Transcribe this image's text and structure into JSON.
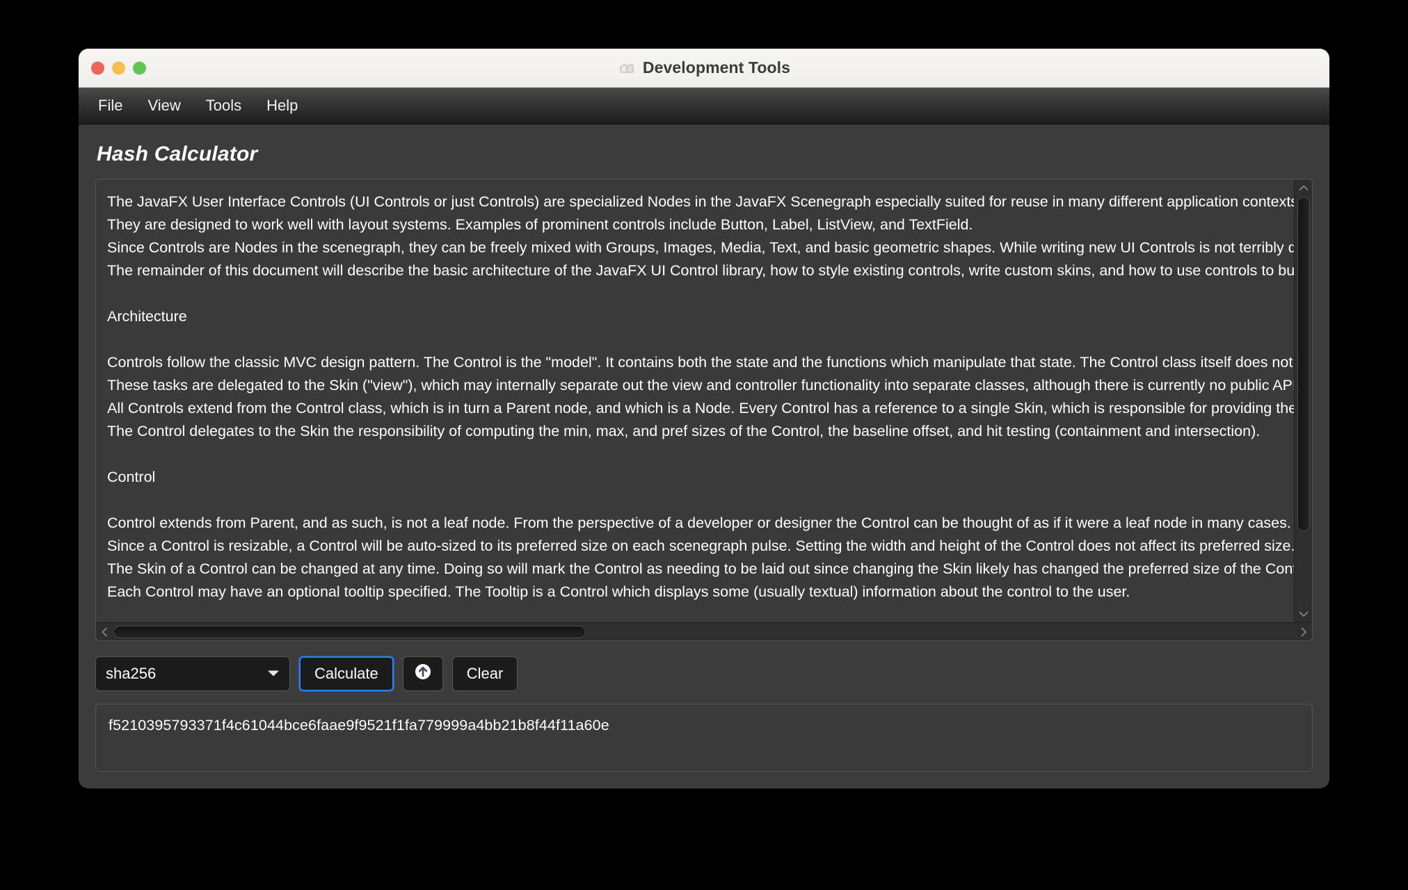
{
  "window": {
    "title": "Development Tools",
    "title_icon": "toolbox-icon",
    "traffic_lights": [
      {
        "name": "close",
        "color": "#f0655b"
      },
      {
        "name": "minimize",
        "color": "#f6bd50"
      },
      {
        "name": "zoom",
        "color": "#62c554"
      }
    ]
  },
  "menubar": {
    "items": [
      {
        "label": "File"
      },
      {
        "label": "View"
      },
      {
        "label": "Tools"
      },
      {
        "label": "Help"
      }
    ]
  },
  "page": {
    "title": "Hash Calculator"
  },
  "textarea": {
    "lines": [
      "The JavaFX User Interface Controls (UI Controls or just Controls) are specialized Nodes in the JavaFX Scenegraph especially suited for reuse in many different application contexts.",
      "They are designed to work well with layout systems. Examples of prominent controls include Button, Label, ListView, and TextField.",
      "Since Controls are Nodes in the scenegraph, they can be freely mixed with Groups, Images, Media, Text, and basic geometric shapes. While writing new UI Controls is not terribly difficult, it does require some knowledge of the scenegraph.",
      "The remainder of this document will describe the basic architecture of the JavaFX UI Control library, how to style existing controls, write custom skins, and how to use controls to build up more complicated user interfaces.",
      "",
      "Architecture",
      "",
      "Controls follow the classic MVC design pattern. The Control is the \"model\". It contains both the state and the functions which manipulate that state. The Control class itself does not perform any rendering or handle input events.",
      "These tasks are delegated to the Skin (\"view\"), which may internally separate out the view and controller functionality into separate classes, although there is currently no public API for the \"controller\" aspect.",
      "All Controls extend from the Control class, which is in turn a Parent node, and which is a Node. Every Control has a reference to a single Skin, which is responsible for providing the implementation of the Control.",
      "The Control delegates to the Skin the responsibility of computing the min, max, and pref sizes of the Control, the baseline offset, and hit testing (containment and intersection).",
      "",
      "Control",
      "",
      "Control extends from Parent, and as such, is not a leaf node. From the perspective of a developer or designer the Control can be thought of as if it were a leaf node in many cases.",
      "Since a Control is resizable, a Control will be auto-sized to its preferred size on each scenegraph pulse. Setting the width and height of the Control does not affect its preferred size.",
      "The Skin of a Control can be changed at any time. Doing so will mark the Control as needing to be laid out since changing the Skin likely has changed the preferred size of the Control.",
      "Each Control may have an optional tooltip specified. The Tooltip is a Control which displays some (usually textual) information about the control to the user."
    ],
    "vertical_scrollbar": {
      "up_arrow": "chevron-up-icon",
      "down_arrow": "chevron-down-icon",
      "thumb_position": "top"
    },
    "horizontal_scrollbar": {
      "left_arrow": "chevron-left-icon",
      "right_arrow": "chevron-right-icon",
      "thumb_position": "left"
    }
  },
  "controls": {
    "algorithm_select": {
      "value": "sha256",
      "caret_icon": "chevron-down-icon"
    },
    "calculate_button": {
      "label": "Calculate",
      "focused": true,
      "focus_color": "#2a7fff"
    },
    "upload_button": {
      "icon": "upload-circle-icon"
    },
    "clear_button": {
      "label": "Clear"
    }
  },
  "result": {
    "hash": "f5210395793371f4c61044bce6faae9f9521f1fa779999a4bb21b8f44f11a60e"
  },
  "theme": {
    "window_background": "#2b2b2b",
    "panel_background": "#3c3c3c",
    "field_background": "#3a3a3a",
    "control_background": "#1c1c1c",
    "border": "#565656",
    "text": "#ffffff",
    "titlebar_background": "#f2f1ef",
    "titlebar_text": "#3b3b3b"
  }
}
